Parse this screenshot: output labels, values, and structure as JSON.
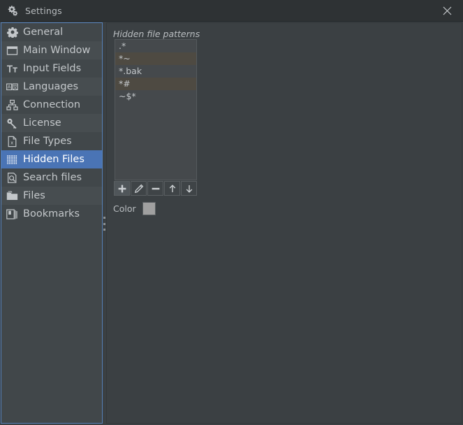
{
  "window": {
    "title": "Settings",
    "title_icon": "cogs-icon",
    "close_icon": "close-icon",
    "background": "#3b4043",
    "titlebar_background": "#2e3234"
  },
  "sidebar": {
    "focus_border_color": "#5580b8",
    "selected_color": "#4a74b5",
    "splitter_name": "sidebar-splitter",
    "items": [
      {
        "label": "General",
        "icon": "gear-icon",
        "selected": false
      },
      {
        "label": "Main Window",
        "icon": "window-icon",
        "selected": false
      },
      {
        "label": "Input Fields",
        "icon": "text-format-icon",
        "selected": false
      },
      {
        "label": "Languages",
        "icon": "languages-icon",
        "selected": false
      },
      {
        "label": "Connection",
        "icon": "network-icon",
        "selected": false
      },
      {
        "label": "License",
        "icon": "key-icon",
        "selected": false
      },
      {
        "label": "File Types",
        "icon": "file-x-icon",
        "selected": false
      },
      {
        "label": "Hidden Files",
        "icon": "grid-dots-icon",
        "selected": true
      },
      {
        "label": "Search files",
        "icon": "file-search-icon",
        "selected": false
      },
      {
        "label": "Files",
        "icon": "folder-icon",
        "selected": false
      },
      {
        "label": "Bookmarks",
        "icon": "bookmarks-icon",
        "selected": false
      }
    ]
  },
  "main": {
    "group_title": "Hidden file patterns",
    "patterns": [
      {
        "value": ".*"
      },
      {
        "value": "*~"
      },
      {
        "value": "*.bak"
      },
      {
        "value": "*#"
      },
      {
        "value": "~$*"
      }
    ],
    "toolbar": [
      {
        "name": "add-pattern-button",
        "icon": "plus-icon",
        "hover": true
      },
      {
        "name": "edit-pattern-button",
        "icon": "pencil-icon",
        "hover": false
      },
      {
        "name": "remove-pattern-button",
        "icon": "minus-icon",
        "hover": false
      },
      {
        "name": "move-up-button",
        "icon": "arrow-up-icon",
        "hover": false
      },
      {
        "name": "move-down-button",
        "icon": "arrow-down-icon",
        "hover": false
      }
    ],
    "color": {
      "label": "Color",
      "swatch_value": "#a0a0a0"
    }
  }
}
